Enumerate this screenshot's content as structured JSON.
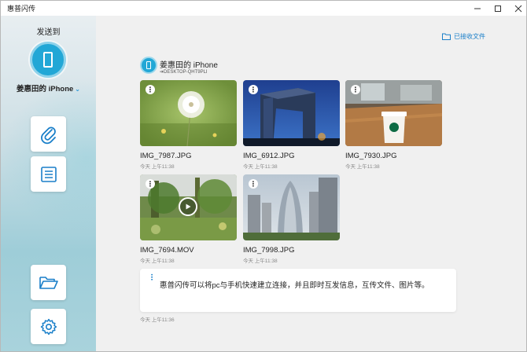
{
  "window": {
    "title": "惠普闪传"
  },
  "sidebar": {
    "send_to": "发送到",
    "device_name": "姜惠田的 iPhone",
    "buttons": [
      "attach-files",
      "send-text",
      "open-folder",
      "settings"
    ]
  },
  "main": {
    "received_link": "已接收文件",
    "contact": {
      "name": "姜惠田的 iPhone",
      "sub": "➔DESKTOP-QHT9PLI"
    },
    "files": [
      {
        "name": "IMG_7987.JPG",
        "date": "今天 上午11:38",
        "type": "image"
      },
      {
        "name": "IMG_6912.JPG",
        "date": "今天 上午11:38",
        "type": "image"
      },
      {
        "name": "IMG_7930.JPG",
        "date": "今天 上午11:38",
        "type": "image"
      },
      {
        "name": "IMG_7694.MOV",
        "date": "今天 上午11:38",
        "type": "video"
      },
      {
        "name": "IMG_7998.JPG",
        "date": "今天 上午11:38",
        "type": "image"
      }
    ],
    "message": {
      "text": "惠普闪传可以将pc与手机快速建立连接，并且即时互发信息，互传文件、图片等。",
      "date": "今天 上午11:36"
    }
  },
  "colors": {
    "accent": "#1a7fc9",
    "device": "#22a7d6"
  }
}
